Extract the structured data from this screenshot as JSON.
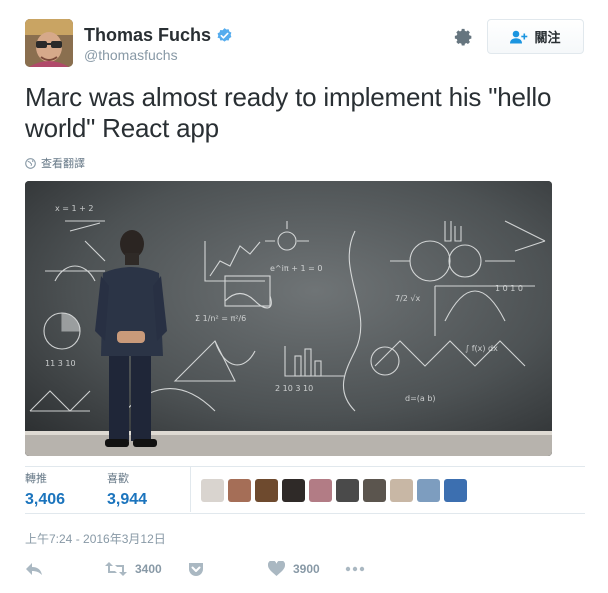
{
  "user": {
    "display_name": "Thomas Fuchs",
    "handle": "@thomasfuchs",
    "verified": true,
    "avatar_icon": "user-avatar"
  },
  "header": {
    "settings_icon": "gear-icon",
    "follow_label": "關注",
    "follow_icon": "add-user-icon"
  },
  "tweet": {
    "text": "Marc was almost ready to implement his \"hello world\" React app",
    "translate_label": "查看翻譯",
    "translate_icon": "globe-icon",
    "photo_description": "man in suit facing chalkboard full of equations"
  },
  "stats": {
    "retweets_label": "轉推",
    "retweets_value": "3,406",
    "likes_label": "喜歡",
    "likes_value": "3,944"
  },
  "likers": [
    {
      "color": "#d9d4cf"
    },
    {
      "color": "#a56e57"
    },
    {
      "color": "#6e4a2e"
    },
    {
      "color": "#2f2a28"
    },
    {
      "color": "#b27c85"
    },
    {
      "color": "#4a4a4a"
    },
    {
      "color": "#5b554e"
    },
    {
      "color": "#c8b7a5"
    },
    {
      "color": "#7d9dbf"
    },
    {
      "color": "#3c6fb0"
    }
  ],
  "timestamp": "上午7:24 - 2016年3月12日",
  "actions": {
    "reply_icon": "reply-icon",
    "retweet_icon": "retweet-icon",
    "retweet_count": "3400",
    "save_icon": "pocket-icon",
    "like_icon": "heart-icon",
    "like_count": "3900",
    "more_icon": "more-icon"
  },
  "colors": {
    "accent": "#1b74bd",
    "verified": "#55acee",
    "muted": "#8899a6",
    "border": "#e1e8ed"
  }
}
